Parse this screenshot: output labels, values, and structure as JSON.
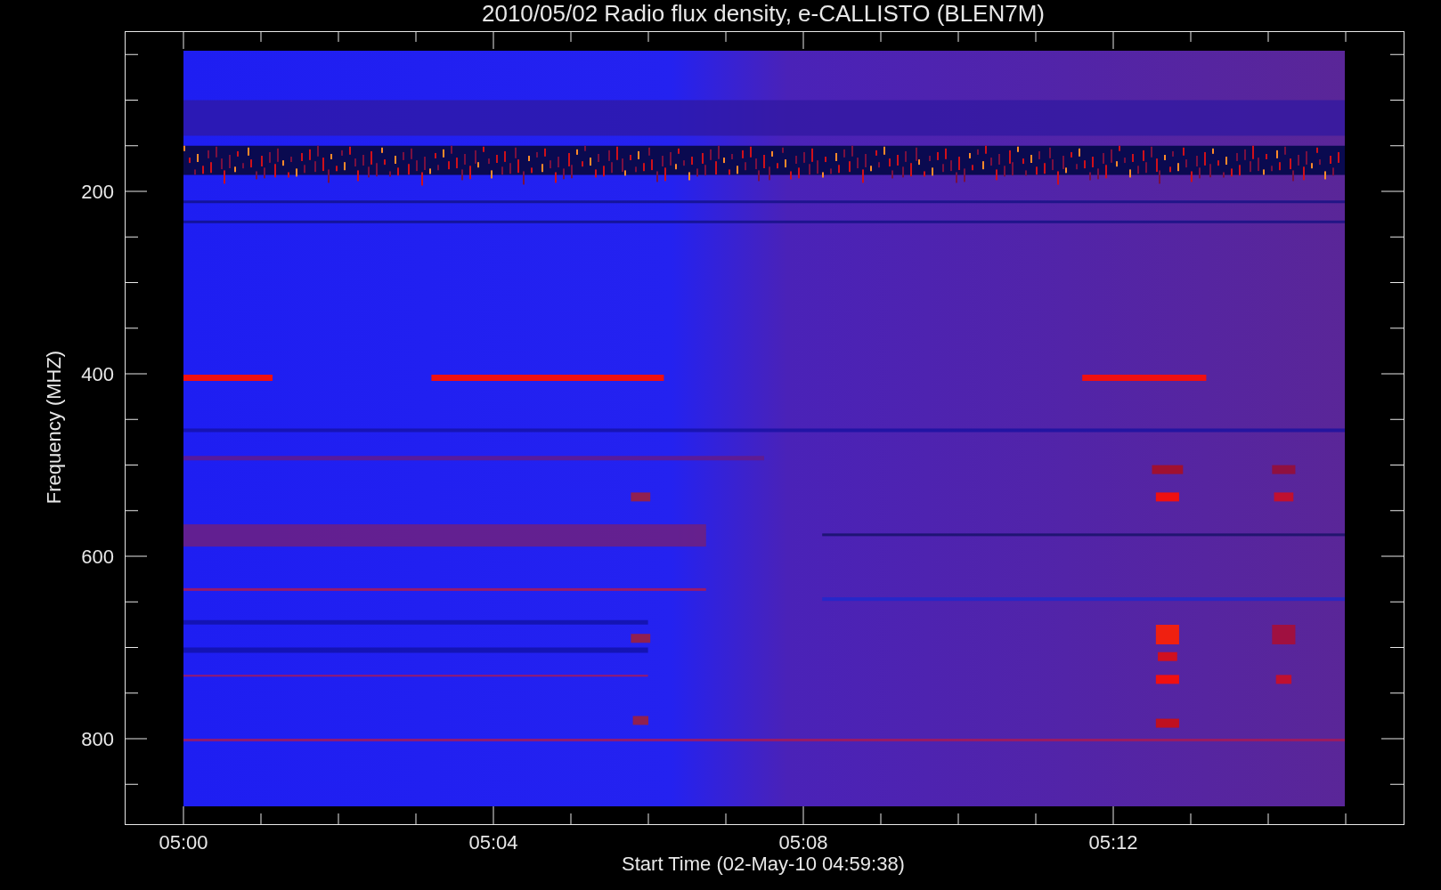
{
  "chart": {
    "title": "2010/05/02  Radio flux density, e-CALLISTO (BLEN7M)",
    "ylabel": "Frequency (MHZ)",
    "xlabel": "Start Time (02-May-10 04:59:38)",
    "yticks": [
      "200",
      "400",
      "600",
      "800"
    ],
    "xticks": [
      "05:00",
      "05:04",
      "05:08",
      "05:12"
    ]
  }
}
